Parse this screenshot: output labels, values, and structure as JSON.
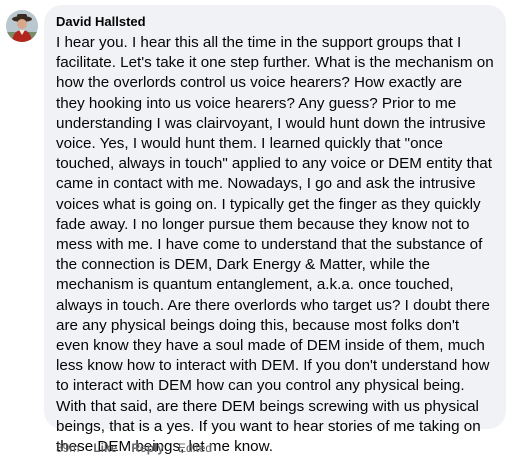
{
  "comment": {
    "author": "David Hallsted",
    "avatar_icon": "user-avatar",
    "body": "I hear you. I hear this all the time in the support groups that I facilitate. Let's take it one step further. What is the mechanism on how the overlords control us voice hearers? How exactly are they hooking into us voice hearers? Any guess? Prior to me understanding I was clairvoyant, I would hunt down the intrusive voice. Yes, I would hunt them. I learned quickly that \"once touched, always in touch\" applied to any voice or DEM entity that came in contact with me. Nowadays, I go and ask the intrusive voices what is going on. I typically get the finger as they quickly fade away. I no longer pursue them because they know not to mess with me. I have come to understand that the substance of the connection is DEM, Dark Energy & Matter, while the mechanism is quantum entanglement, a.k.a. once touched, always in touch. Are there overlords who target us? I doubt there are any physical beings doing this, because most folks don't even know they have a soul made of DEM inside of them, much less know how to interact with DEM. If you don't understand how to interact with DEM how can you control any physical being. With that said, are there DEM beings screwing with us physical beings, that is a yes. If you want to hear stories of me taking on these DEM beings, let me know.",
    "timestamp": "39m",
    "like_label": "Like",
    "reply_label": "Reply",
    "edited_label": "Edited"
  },
  "colors": {
    "bubble_bg": "#f0f2f5",
    "text": "#050505",
    "meta_text": "#65676b"
  }
}
